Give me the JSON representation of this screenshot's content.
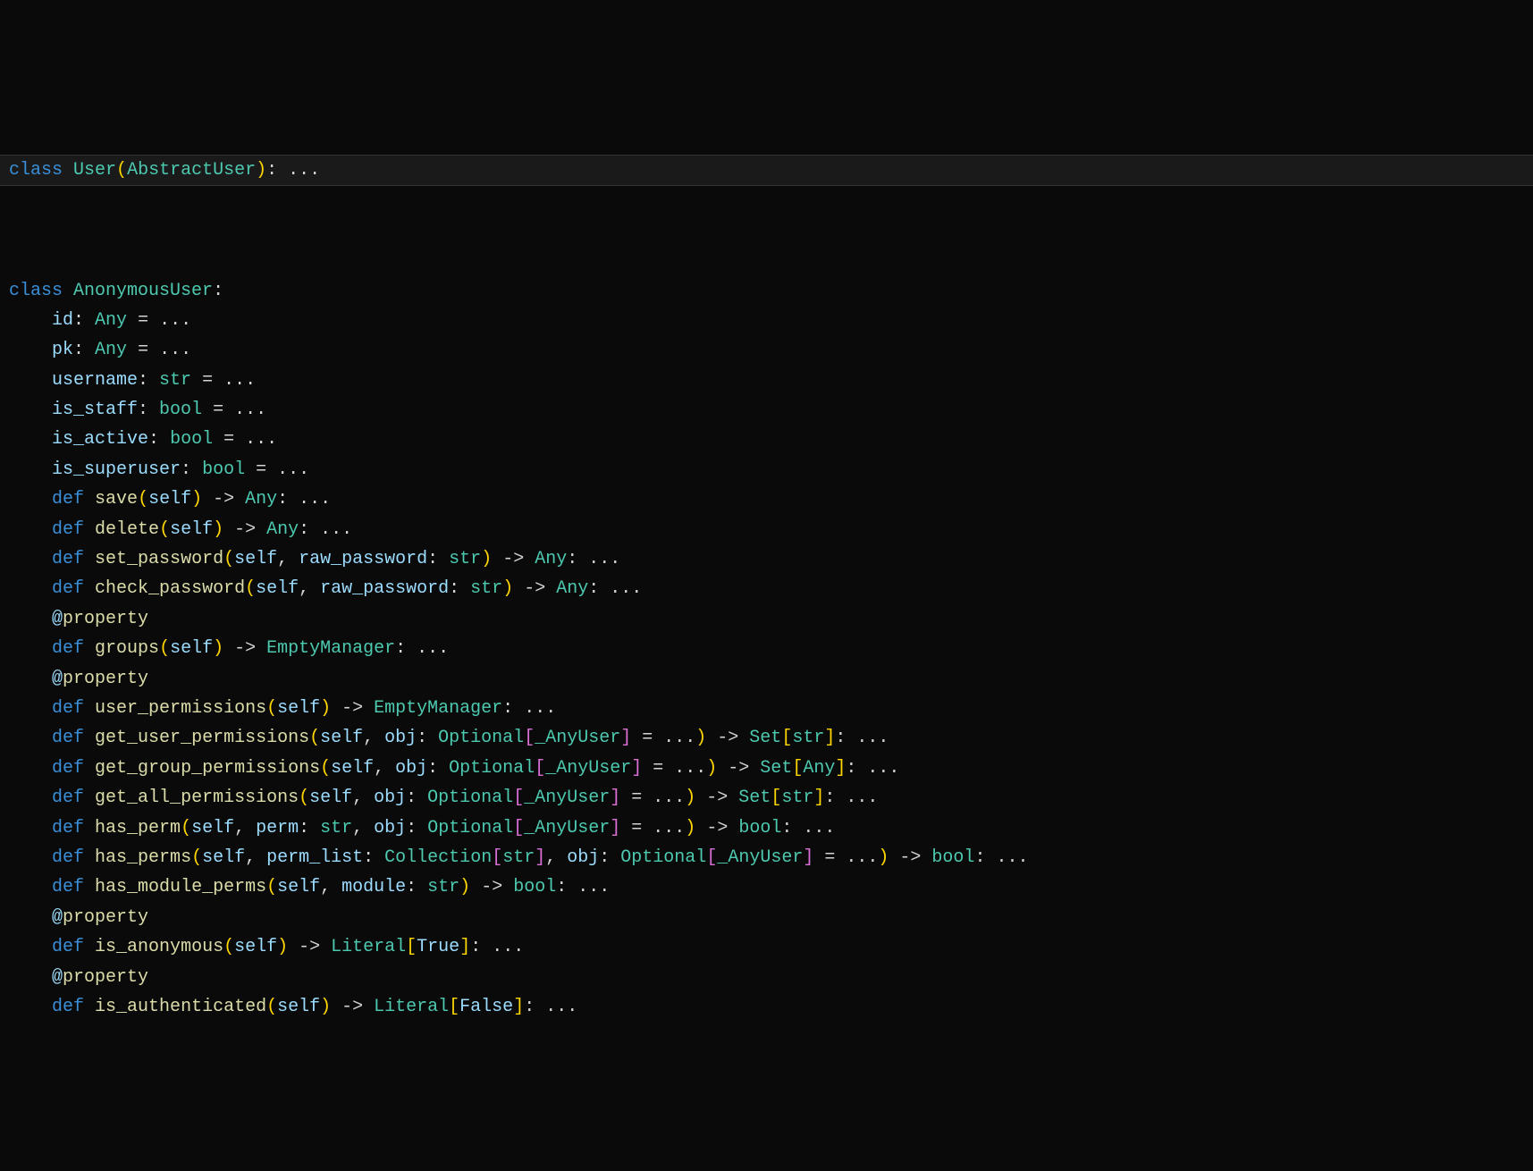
{
  "code": {
    "line1": {
      "kw_class": "class",
      "name": "User",
      "base": "AbstractUser",
      "ellipsis": "..."
    },
    "line2": {
      "kw_class": "class",
      "name": "AnonymousUser"
    },
    "members": {
      "id": "id",
      "pk": "pk",
      "username": "username",
      "is_staff": "is_staff",
      "is_active": "is_active",
      "is_superuser": "is_superuser"
    },
    "types": {
      "Any": "Any",
      "str": "str",
      "bool": "bool",
      "EmptyManager": "EmptyManager",
      "Optional": "Optional",
      "AnyUser": "_AnyUser",
      "Set": "Set",
      "Collection": "Collection",
      "Literal": "Literal",
      "True": "True",
      "False": "False"
    },
    "methods": {
      "save": "save",
      "delete": "delete",
      "set_password": "set_password",
      "check_password": "check_password",
      "groups": "groups",
      "user_permissions": "user_permissions",
      "get_user_permissions": "get_user_permissions",
      "get_group_permissions": "get_group_permissions",
      "get_all_permissions": "get_all_permissions",
      "has_perm": "has_perm",
      "has_perms": "has_perms",
      "has_module_perms": "has_module_perms",
      "is_anonymous": "is_anonymous",
      "is_authenticated": "is_authenticated"
    },
    "params": {
      "self": "self",
      "raw_password": "raw_password",
      "obj": "obj",
      "perm": "perm",
      "perm_list": "perm_list",
      "module": "module"
    },
    "tokens": {
      "def": "def",
      "ellipsis": "...",
      "property": "property",
      "eq": " = ",
      "arrow": " -> ",
      "colon": ": ",
      "comma": ", "
    }
  }
}
